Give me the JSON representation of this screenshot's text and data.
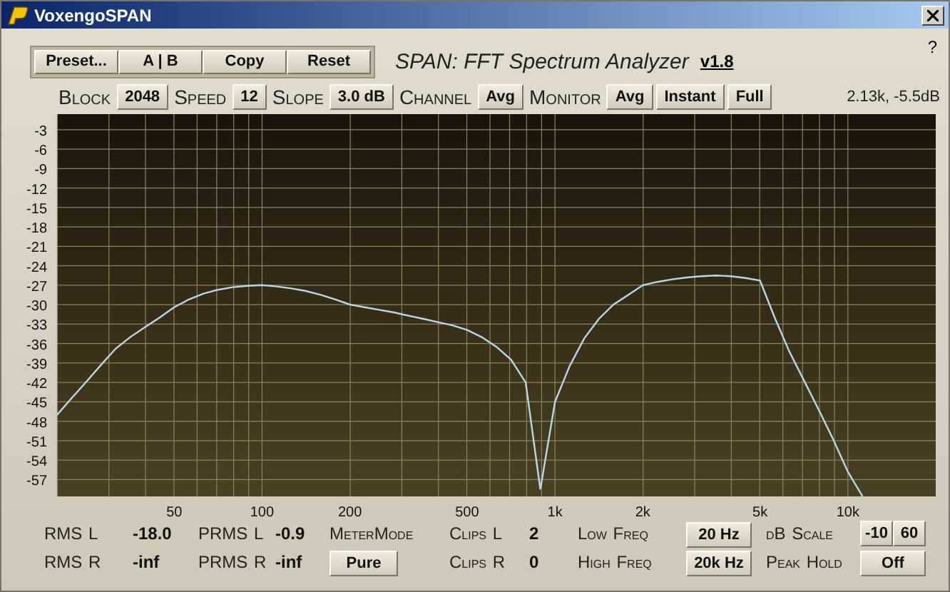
{
  "window": {
    "title": "VoxengoSPAN"
  },
  "toolbar": {
    "buttons": [
      "Preset...",
      "A | B",
      "Copy",
      "Reset"
    ],
    "app_title": "SPAN: FFT Spectrum Analyzer",
    "version": "v1.8",
    "help": "?"
  },
  "settings": [
    {
      "kind": "label",
      "text": "Block"
    },
    {
      "kind": "button",
      "text": "2048"
    },
    {
      "kind": "label",
      "text": "Speed"
    },
    {
      "kind": "button",
      "text": "12"
    },
    {
      "kind": "label",
      "text": "Slope"
    },
    {
      "kind": "button",
      "text": "3.0 dB"
    },
    {
      "kind": "label",
      "text": "Channel"
    },
    {
      "kind": "button",
      "text": "Avg"
    },
    {
      "kind": "label",
      "text": "Monitor"
    },
    {
      "kind": "button",
      "text": "Avg"
    },
    {
      "kind": "button",
      "text": "Instant"
    },
    {
      "kind": "button",
      "text": "Full"
    }
  ],
  "readout": "2.13k, -5.5dB",
  "spectrum": {
    "chart_data": {
      "type": "line",
      "grid": true,
      "ylim": [
        -59.6,
        -0.6
      ],
      "categories": [
        null,
        null,
        null,
        null,
        null,
        null,
        null,
        null,
        "50",
        null,
        null,
        null,
        null,
        null,
        "100",
        null,
        null,
        null,
        null,
        null,
        "200",
        null,
        null,
        null,
        null,
        null,
        null,
        null,
        "500",
        null,
        null,
        null,
        null,
        null,
        "1k",
        null,
        null,
        null,
        null,
        null,
        "2k",
        null,
        null,
        null,
        null,
        null,
        null,
        null,
        "5k",
        null,
        null,
        null,
        null,
        null,
        "10k",
        null,
        null,
        null,
        null,
        null,
        null
      ],
      "yticks": [
        -3,
        -6,
        -9,
        -12,
        -15,
        -18,
        -21,
        -24,
        -27,
        -30,
        -33,
        -36,
        -39,
        -42,
        -45,
        -48,
        -51,
        -54,
        -57
      ],
      "series": [
        {
          "color": "#b8d8e8",
          "values": [
            -47,
            -44.4,
            -41.9,
            -39.3,
            -36.8,
            -35,
            -33.5,
            -32,
            -30.4,
            -29.2,
            -28.3,
            -27.7,
            -27.3,
            -27.1,
            -27,
            -27.2,
            -27.5,
            -27.9,
            -28.5,
            -29.2,
            -30,
            -30.4,
            -30.8,
            -31.2,
            -31.7,
            -32.2,
            -32.7,
            -33.2,
            -33.9,
            -35,
            -36.5,
            -38.5,
            -42,
            -58.5,
            -45,
            -39.5,
            -35.2,
            -32.2,
            -30,
            -28.5,
            -27,
            -26.5,
            -26.1,
            -25.8,
            -25.6,
            -25.5,
            -25.6,
            -25.9,
            -26.3,
            -32,
            -37.2,
            -41.7,
            -46.2,
            -50.8,
            -55.8,
            -59.6,
            null,
            null,
            null,
            null,
            null
          ]
        }
      ]
    }
  },
  "meters": [
    [
      {
        "kind": "label",
        "text": "RMS L"
      },
      {
        "kind": "value",
        "text": "-18.0"
      },
      {
        "kind": "label",
        "text": "PRMS L"
      },
      {
        "kind": "value",
        "text": "-0.9"
      },
      {
        "kind": "label",
        "text": "MeterMode"
      },
      {
        "kind": "label",
        "text": "Clips L"
      },
      {
        "kind": "value",
        "text": "2"
      },
      {
        "kind": "label",
        "text": "Low Freq"
      },
      {
        "kind": "button",
        "text": "20 Hz"
      },
      {
        "kind": "label",
        "text": "dB Scale"
      },
      {
        "kind": "pair",
        "texts": [
          "-10",
          "60"
        ]
      }
    ],
    [
      {
        "kind": "label",
        "text": "RMS R"
      },
      {
        "kind": "value",
        "text": "-inf"
      },
      {
        "kind": "label",
        "text": "PRMS R"
      },
      {
        "kind": "value",
        "text": "-inf"
      },
      {
        "kind": "button",
        "text": "Pure"
      },
      {
        "kind": "label",
        "text": "Clips R"
      },
      {
        "kind": "value",
        "text": "0"
      },
      {
        "kind": "label",
        "text": "High Freq"
      },
      {
        "kind": "button",
        "text": "20k Hz"
      },
      {
        "kind": "label",
        "text": "Peak Hold"
      },
      {
        "kind": "button",
        "text": "Off"
      }
    ]
  ]
}
